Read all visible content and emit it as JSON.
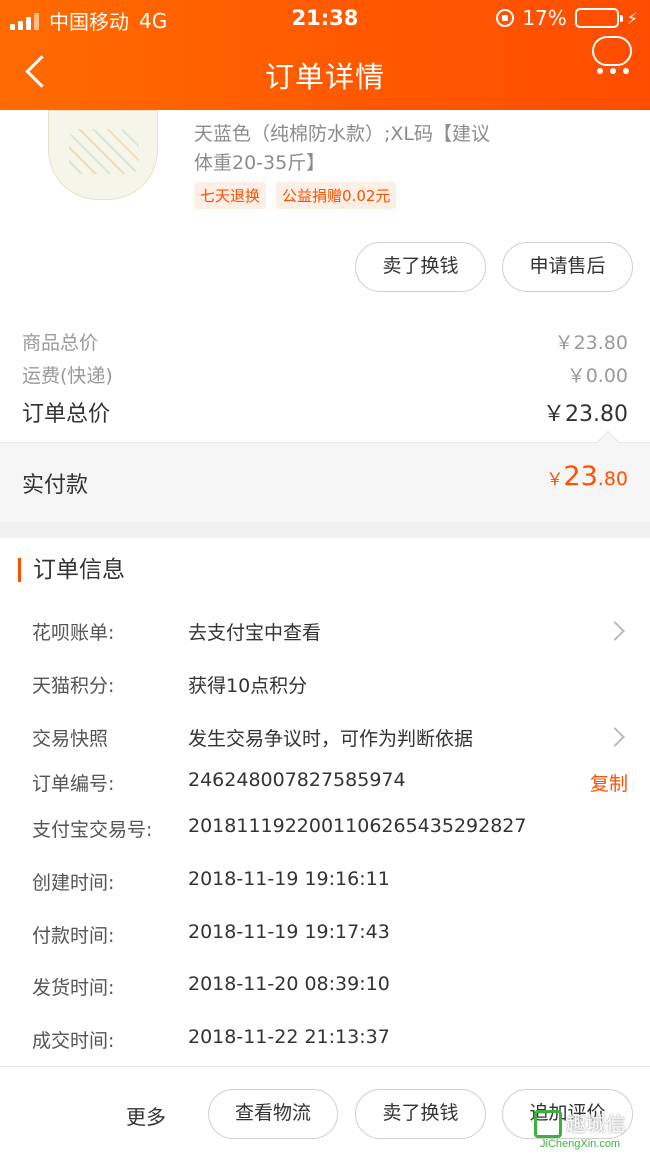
{
  "status_bar": {
    "carrier": "中国移动",
    "network": "4G",
    "time": "21:38",
    "battery_percent": "17%",
    "battery_level": 0.17
  },
  "nav": {
    "title": "订单详情"
  },
  "product": {
    "desc_line1": "天蓝色（纯棉防水款）;XL码【建议",
    "desc_line2": "体重20-35斤】",
    "tags": [
      "七天退换",
      "公益捐赠0.02元"
    ]
  },
  "item_actions": {
    "sell_label": "卖了换钱",
    "after_sale_label": "申请售后"
  },
  "summary": {
    "goods_total_label": "商品总价",
    "goods_total_value": "￥23.80",
    "shipping_label": "运费(快递)",
    "shipping_value": "￥0.00",
    "order_total_label": "订单总价",
    "order_total_value": "￥23.80",
    "paid_label": "实付款",
    "paid_currency": "￥",
    "paid_int": "23",
    "paid_dec": ".80"
  },
  "order_info": {
    "title": "订单信息",
    "rows": [
      {
        "key": "花呗账单:",
        "value": "去支付宝中查看"
      },
      {
        "key": "天猫积分:",
        "value": "获得10点积分"
      },
      {
        "key": "交易快照",
        "value": "发生交易争议时，可作为判断依据"
      },
      {
        "key": "订单编号:",
        "value": "246248007827585974"
      },
      {
        "key": "支付宝交易号:",
        "value": "2018111922001106265435292827"
      },
      {
        "key": "创建时间:",
        "value": "2018-11-19 19:16:11"
      },
      {
        "key": "付款时间:",
        "value": "2018-11-19 19:17:43"
      },
      {
        "key": "发货时间:",
        "value": "2018-11-20 08:39:10"
      },
      {
        "key": "成交时间:",
        "value": "2018-11-22 21:13:37"
      }
    ],
    "copy_label": "复制"
  },
  "bottom_bar": {
    "more_label": "更多",
    "logistics_label": "查看物流",
    "sell_label": "卖了换钱",
    "review_label": "追加评价"
  },
  "watermark": {
    "text": "趣城信",
    "url": "JiChengXin.com"
  }
}
